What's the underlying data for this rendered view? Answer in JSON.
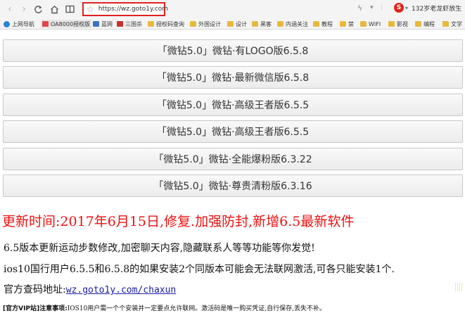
{
  "browser": {
    "url": "https://wz.goto1y.com",
    "user_name": "132岁老龙虾放生",
    "user_badge": "S",
    "bookmarks": [
      "上网导航",
      "OA8000授权版",
      "蓝网",
      "三国杀",
      "授权码查询",
      "外国设计",
      "设计",
      "黑客",
      "内涵关注",
      "教程",
      "禁",
      "WIFI",
      "影视",
      "编程",
      "文学"
    ]
  },
  "versions": [
    "「微钻5.0」微钻·有LOGO版6.5.8",
    "「微钻5.0」微钻·最新微信版6.5.8",
    "「微钻5.0」微钻·高级王者版6.5.5",
    "「微钻5.0」微钻·高级王者版6.5.5",
    "「微钻5.0」微钻·全能爆粉版6.3.22",
    "「微钻5.0」微钻·尊贵清粉版6.3.16"
  ],
  "content": {
    "headline": "更新时间:2017年6月15日,修复.加强防封,新增6.5最新软件",
    "line1": "6.5版本更新运动步数修改,加密聊天内容,隐藏联系人等等功能等你发觉!",
    "line2": "ios10国行用户6.5.5和6.5.8的如果安装2个同版本可能会无法联网激活,可各只能安装1个.",
    "lookup_label": "官方查码地址:",
    "lookup_link": "wz.goto1y.com/chaxun",
    "notice_prefix": "[官方VIP站]注意事项:",
    "notice_text": "IOS10用户需一个个安装并一定要点允许联网。激活码是唯一购买凭证,自行保存,丢失不补。"
  }
}
